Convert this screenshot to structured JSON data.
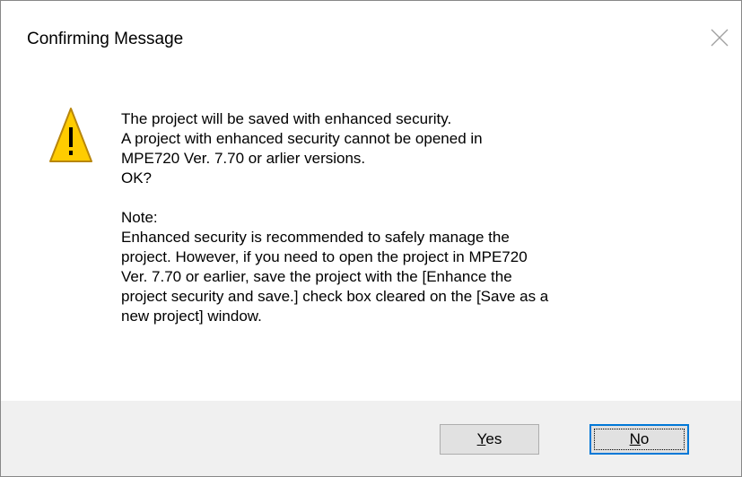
{
  "dialog": {
    "title": "Confirming Message",
    "icon": "warning-icon",
    "icon_colors": {
      "fill": "#ffcc00",
      "outline": "#b8860b",
      "mark": "#000000"
    },
    "message_lines": [
      "The project will be saved with enhanced security.",
      "A project with enhanced security cannot be opened in",
      "MPE720 Ver. 7.70 or arlier versions.",
      "OK?"
    ],
    "note_lines": [
      "Note:",
      "Enhanced security is recommended to safely manage the",
      "project. However, if you need to open the project in MPE720",
      "Ver. 7.70 or earlier, save the project with the [Enhance the",
      "project security and save.] check box cleared on the [Save as a",
      "new project] window."
    ]
  },
  "buttons": {
    "yes": {
      "accel": "Y",
      "rest": "es"
    },
    "no": {
      "accel": "N",
      "rest": "o"
    }
  },
  "colors": {
    "focus_border": "#0078d7",
    "footer_background": "#f0f0f0",
    "button_background": "#e1e1e1"
  }
}
